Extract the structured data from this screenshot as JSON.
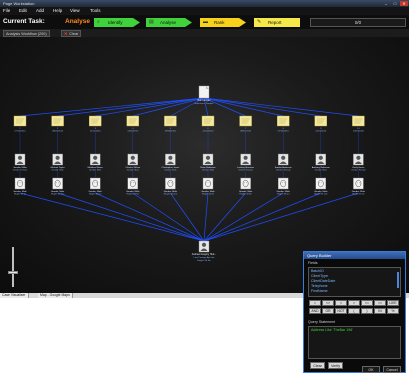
{
  "window": {
    "title": "Page Workstation",
    "minimize_glyph": "–",
    "maximize_glyph": "□",
    "close_glyph": "✕"
  },
  "menu": [
    {
      "label": "File"
    },
    {
      "label": "Edit"
    },
    {
      "label": "Add"
    },
    {
      "label": "Help"
    },
    {
      "label": "View"
    },
    {
      "label": "Tools"
    }
  ],
  "task": {
    "label": "Current Task:",
    "value": "Analyse"
  },
  "workflow_buttons": [
    {
      "label": "Identify",
      "color": "#3fd23a"
    },
    {
      "label": "Analyse",
      "color": "#3fd23a"
    },
    {
      "label": "Rank",
      "color": "#f7d21a"
    },
    {
      "label": "Report",
      "color": "#f7e84a"
    }
  ],
  "counter": {
    "value": "0/0"
  },
  "tabs": [
    {
      "label": "Analysis Workflow (200)"
    },
    {
      "label": "Clear"
    }
  ],
  "canvas_controls": {
    "pin": "▾",
    "close": "✕"
  },
  "graph": {
    "root": {
      "line1": "Bob Morgan",
      "line2": "Reference: Sample"
    },
    "docs": [
      {
        "id": "1",
        "date": "07/16/2010"
      },
      {
        "id": "2",
        "date": "08/25/2010"
      },
      {
        "id": "3",
        "date": "12/17/2010"
      },
      {
        "id": "4",
        "date": "11/05/2010"
      },
      {
        "id": "5",
        "date": "09/28/2010"
      },
      {
        "id": "6",
        "date": "10/11/2010"
      },
      {
        "id": "7",
        "date": "08/11/2010"
      },
      {
        "id": "8",
        "date": "07/26/2010"
      },
      {
        "id": "9",
        "date": "12/01/2010"
      },
      {
        "id": "10",
        "date": "10/20/2010"
      }
    ],
    "persons": [
      {
        "name": "Jennifer Miller",
        "sub": "Gender: Female"
      },
      {
        "name": "Michael Taylor",
        "sub": "Gender: Male"
      },
      {
        "name": "Matthew Moore",
        "sub": "Gender: Male"
      },
      {
        "name": "Charles Wilson",
        "sub": "Gender: Male"
      },
      {
        "name": "Christopher Jones",
        "sub": "Gender: Male"
      },
      {
        "name": "Brian Robinson",
        "sub": "Gender: Male"
      },
      {
        "name": "Lindsay Morrison",
        "sub": "Gender: Female"
      },
      {
        "name": "Sandra Anderson",
        "sub": "Gender: Female"
      },
      {
        "name": "Anthony Robinson",
        "sub": "Gender: Male"
      },
      {
        "name": "Emily Harris",
        "sub": "Gender: Female"
      }
    ],
    "faces": [
      {
        "name": "Gender: Male",
        "sub": "Height: 6ft 1in"
      },
      {
        "name": "Gender: Male",
        "sub": "Height: 5ft 10in"
      },
      {
        "name": "Gender: Male",
        "sub": "Height: 6ft 0in"
      },
      {
        "name": "Gender: Male",
        "sub": "Height: 5ft 9in"
      },
      {
        "name": "Gender: Male",
        "sub": "Height: 5ft 11in"
      },
      {
        "name": "Gender: Male",
        "sub": "Height: 6ft 2in"
      },
      {
        "name": "Gender: Male",
        "sub": "Height: 5ft 8in"
      },
      {
        "name": "Gender: Male",
        "sub": "Height: 6ft 0in"
      },
      {
        "name": "Gender: Male",
        "sub": "Height: 5ft 10in"
      },
      {
        "name": "Gender: Male",
        "sub": "Height: 6ft 1in"
      }
    ],
    "target": {
      "line1": "Andrew Gregory Hud...",
      "line2": "Last Postage Apt info",
      "line3": "Height: 6ft 0in"
    }
  },
  "zoom": {
    "level": 0.35
  },
  "bottom_tabs": [
    {
      "label": "Case Visualiser"
    },
    {
      "label": "Map - Google Maps"
    }
  ],
  "query_dialog": {
    "title": "Query Builder",
    "fields_label": "Fields",
    "fields": [
      "BatchID",
      "ClientType",
      "ClientDateDate",
      "Telephone",
      "FirstName"
    ],
    "operators_row1": [
      "=",
      "<>",
      "<",
      ">",
      "<=",
      ">=",
      "LIKE"
    ],
    "operators_row2": [
      "AND",
      "OR",
      "NOT",
      "(",
      ")",
      "IN",
      "%"
    ],
    "statement_label": "Query Statement",
    "statement_value": "Address Like 'TheBar 196'",
    "clear_label": "Clear",
    "verify_label": "Verify",
    "ok_label": "OK",
    "cancel_label": "Cancel"
  },
  "colors": {
    "accent_orange": "#ff8a1c",
    "link_blue": "#1f4fff",
    "dialog_border": "#3a7cdd"
  }
}
